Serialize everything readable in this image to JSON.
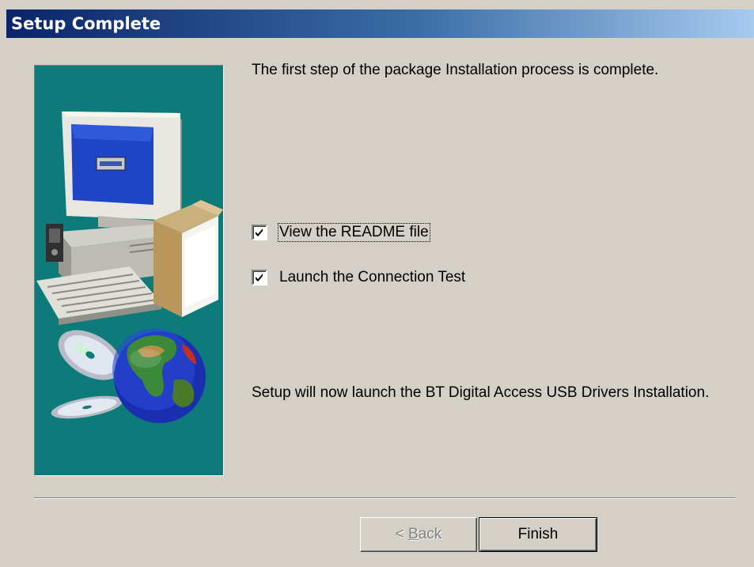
{
  "window": {
    "title": "Setup Complete"
  },
  "content": {
    "intro": "The first step of the package Installation process is complete.",
    "options": [
      {
        "label": "View the README file",
        "checked": true
      },
      {
        "label": "Launch the Connection Test",
        "checked": true
      }
    ],
    "note": "Setup will now launch the BT Digital Access USB Drivers Installation."
  },
  "buttons": {
    "back_prefix": "< ",
    "back_mnemonic": "B",
    "back_rest": "ack",
    "finish": "Finish"
  },
  "colors": {
    "panel_bg": "#0e7b7b",
    "titlebar_start": "#0a246a",
    "titlebar_end": "#a6caf0",
    "dialog_bg": "#d4d0c8"
  },
  "illustration": {
    "icons": [
      "computer-icon",
      "software-box-icon",
      "cd-disc-icon",
      "globe-icon"
    ]
  }
}
